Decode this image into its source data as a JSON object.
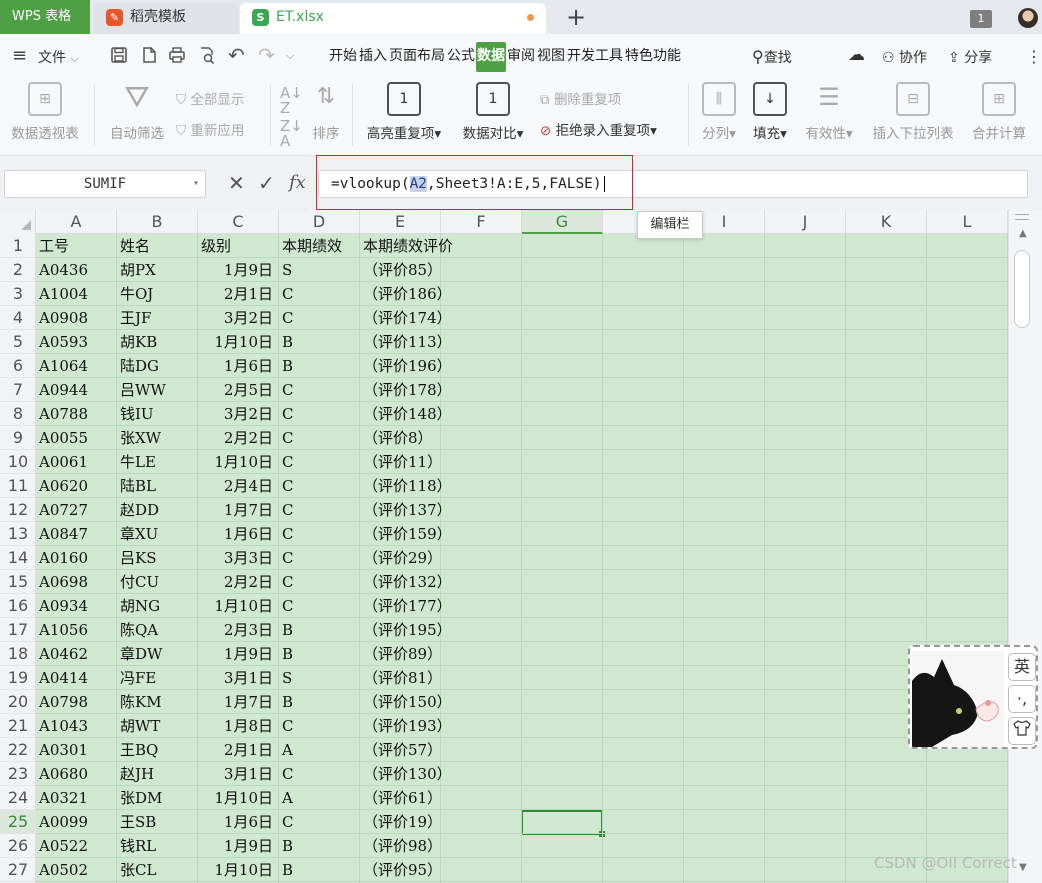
{
  "tabs": {
    "app": "WPS 表格",
    "template": "稻壳模板",
    "file": "ET.xlsx",
    "add": "+"
  },
  "window_count": "1",
  "menu": {
    "file_label": "文件",
    "tabs": [
      "开始",
      "插入",
      "页面布局",
      "公式",
      "数据",
      "审阅",
      "视图",
      "开发工具",
      "特色功能"
    ],
    "active_tab": "数据",
    "search": "查找",
    "collab": "协作",
    "share": "分享"
  },
  "ribbon": {
    "pivot": "数据透视表",
    "autofilter": "自动筛选",
    "show_all": "全部显示",
    "reapply": "重新应用",
    "sort": "排序",
    "highlight_dup": "高亮重复项",
    "compare": "数据对比",
    "delete_dup": "删除重复项",
    "reject_dup": "拒绝录入重复项",
    "split": "分列",
    "fill": "填充",
    "validity": "有效性",
    "insert_dropdown": "插入下拉列表",
    "merge_calc": "合并计算"
  },
  "formula_bar": {
    "name_box": "SUMIF",
    "formula_prefix": "=vlookup(",
    "formula_highlight": "A2",
    "formula_suffix": ",Sheet3!A:E,5,FALSE)",
    "tooltip": "编辑栏"
  },
  "sheet": {
    "columns": [
      "A",
      "B",
      "C",
      "D",
      "E",
      "F",
      "G",
      "H",
      "I",
      "J",
      "K",
      "L"
    ],
    "selected_column": "G",
    "selected_row": "25",
    "header_row": [
      "工号",
      "姓名",
      "级别",
      "本期绩效",
      "本期绩效评价"
    ],
    "rows": [
      [
        "A0436",
        "胡PX",
        "1月9日",
        "S",
        "（评价85）"
      ],
      [
        "A1004",
        "牛OJ",
        "2月1日",
        "C",
        "（评价186）"
      ],
      [
        "A0908",
        "王JF",
        "3月2日",
        "C",
        "（评价174）"
      ],
      [
        "A0593",
        "胡KB",
        "1月10日",
        "B",
        "（评价113）"
      ],
      [
        "A1064",
        "陆DG",
        "1月6日",
        "B",
        "（评价196）"
      ],
      [
        "A0944",
        "吕WW",
        "2月5日",
        "C",
        "（评价178）"
      ],
      [
        "A0788",
        "钱IU",
        "3月2日",
        "C",
        "（评价148）"
      ],
      [
        "A0055",
        "张XW",
        "2月2日",
        "C",
        "（评价8）"
      ],
      [
        "A0061",
        "牛LE",
        "1月10日",
        "C",
        "（评价11）"
      ],
      [
        "A0620",
        "陆BL",
        "2月4日",
        "C",
        "（评价118）"
      ],
      [
        "A0727",
        "赵DD",
        "1月7日",
        "C",
        "（评价137）"
      ],
      [
        "A0847",
        "章XU",
        "1月6日",
        "C",
        "（评价159）"
      ],
      [
        "A0160",
        "吕KS",
        "3月3日",
        "C",
        "（评价29）"
      ],
      [
        "A0698",
        "付CU",
        "2月2日",
        "C",
        "（评价132）"
      ],
      [
        "A0934",
        "胡NG",
        "1月10日",
        "C",
        "（评价177）"
      ],
      [
        "A1056",
        "陈QA",
        "2月3日",
        "B",
        "（评价195）"
      ],
      [
        "A0462",
        "章DW",
        "1月9日",
        "B",
        "（评价89）"
      ],
      [
        "A0414",
        "冯FE",
        "3月1日",
        "S",
        "（评价81）"
      ],
      [
        "A0798",
        "陈KM",
        "1月7日",
        "B",
        "（评价150）"
      ],
      [
        "A1043",
        "胡WT",
        "1月8日",
        "C",
        "（评价193）"
      ],
      [
        "A0301",
        "王BQ",
        "2月1日",
        "A",
        "（评价57）"
      ],
      [
        "A0680",
        "赵JH",
        "3月1日",
        "C",
        "（评价130）"
      ],
      [
        "A0321",
        "张DM",
        "1月10日",
        "A",
        "（评价61）"
      ],
      [
        "A0099",
        "王SB",
        "1月6日",
        "C",
        "（评价19）"
      ],
      [
        "A0522",
        "钱RL",
        "1月9日",
        "B",
        "（评价98）"
      ],
      [
        "A0502",
        "张CL",
        "1月10日",
        "B",
        "（评价95）"
      ]
    ]
  },
  "ime": {
    "lang": "英",
    "punct": "·,",
    "skin": "shirt-icon"
  },
  "watermark": "CSDN @OII Correct",
  "colors": {
    "wps_green": "#4f9f45",
    "sheet_bg": "#cfe8cf",
    "red_highlight": "#e02020"
  }
}
